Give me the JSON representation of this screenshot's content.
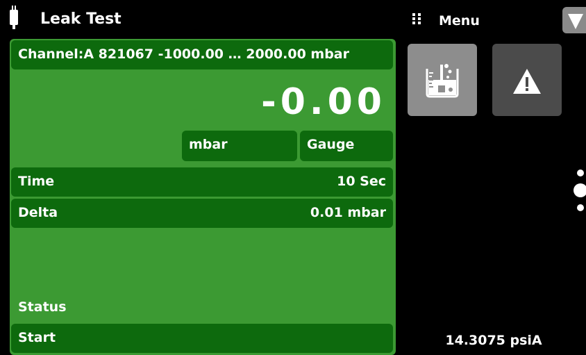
{
  "header": {
    "title": "Leak Test",
    "icon": "sensor-probe-icon"
  },
  "menu": {
    "label": "Menu",
    "grip_icon": "grip-dots-icon",
    "dropdown_icon": "chevron-down-icon"
  },
  "panel": {
    "channel": "Channel:A 821067 -1000.00 … 2000.00 mbar",
    "reading": "-0.00",
    "unit": "mbar",
    "mode": "Gauge",
    "time_label": "Time",
    "time_value": "10 Sec",
    "delta_label": "Delta",
    "delta_value": "0.01 mbar",
    "status_label": "Status",
    "start_label": "Start"
  },
  "sidebar": {
    "tiles": [
      {
        "icon": "leak-test-beaker-icon"
      },
      {
        "icon": "warning-icon"
      }
    ],
    "page_indicator": {
      "pages": 3,
      "current": 2
    },
    "barometer": "14.3075 psiA"
  },
  "colors": {
    "panel_green": "#3c9a33",
    "row_green": "#0d6a0d",
    "active_tile": "#8d8d8d",
    "inactive_tile": "#4b4b4b"
  }
}
